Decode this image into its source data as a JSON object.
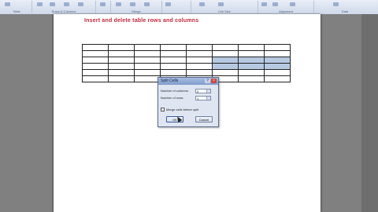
{
  "window": {
    "title": ""
  },
  "ribbon": {
    "groups": [
      {
        "label": "Table"
      },
      {
        "label": "Rows & Columns"
      },
      {
        "label": ""
      },
      {
        "label": "Merge"
      },
      {
        "label": ""
      },
      {
        "label": "Cell Size"
      },
      {
        "label": "Alignment"
      },
      {
        "label": "Data"
      }
    ]
  },
  "document": {
    "heading": "Insert and delete table rows and columns"
  },
  "table": {
    "rows": 6,
    "cols": 8
  },
  "dialog": {
    "title": "Split Cells",
    "help_icon": "?",
    "close_icon": "×",
    "columns_label": "Number of columns:",
    "columns_value": "2",
    "rows_label": "Number of rows:",
    "rows_value": "1",
    "merge_label": "Merge cells before split",
    "ok_label": "OK",
    "cancel_label": "Cancel"
  },
  "colors": {
    "heading": "#c0283c",
    "selection": "#b7c9e2",
    "ribbon": "#dbe4f1"
  }
}
